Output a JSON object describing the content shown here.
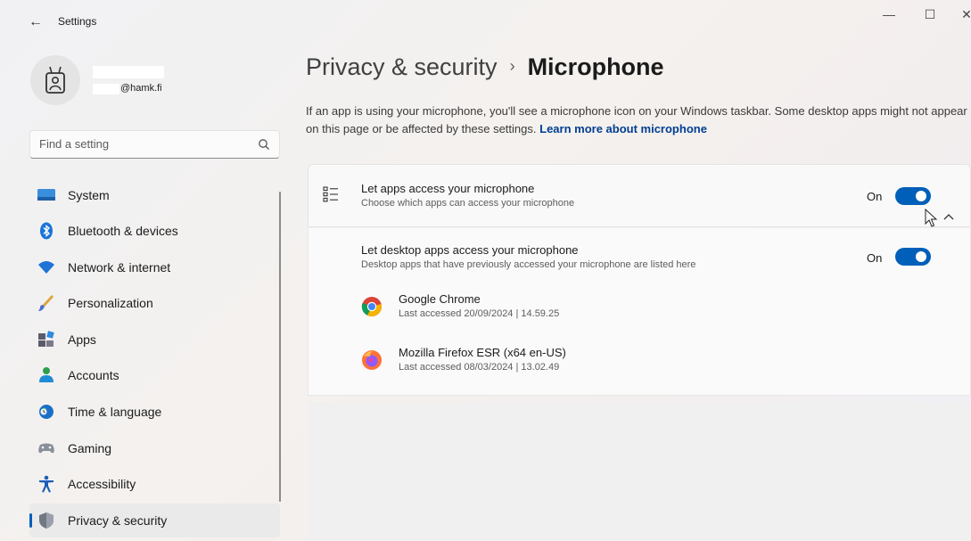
{
  "titlebar": {
    "title": "Settings",
    "back_icon": "←",
    "minimize_icon": "—",
    "maximize_icon": "☐",
    "close_icon": "✕"
  },
  "profile": {
    "email": "@hamk.fi"
  },
  "search": {
    "placeholder": "Find a setting"
  },
  "sidebar": {
    "items": [
      {
        "label": "System",
        "icon": "monitor-icon"
      },
      {
        "label": "Bluetooth & devices",
        "icon": "bluetooth-icon"
      },
      {
        "label": "Network & internet",
        "icon": "wifi-icon"
      },
      {
        "label": "Personalization",
        "icon": "brush-icon"
      },
      {
        "label": "Apps",
        "icon": "apps-icon"
      },
      {
        "label": "Accounts",
        "icon": "person-icon"
      },
      {
        "label": "Time & language",
        "icon": "globe-clock-icon"
      },
      {
        "label": "Gaming",
        "icon": "gamepad-icon"
      },
      {
        "label": "Accessibility",
        "icon": "accessibility-icon"
      },
      {
        "label": "Privacy & security",
        "icon": "shield-icon",
        "active": true
      }
    ]
  },
  "main": {
    "breadcrumb": {
      "parent": "Privacy & security",
      "separator": "›",
      "current": "Microphone"
    },
    "description": "If an app is using your microphone, you'll see a microphone icon on your Windows taskbar. Some desktop apps might not appear on this page or be affected by these settings.",
    "learn_more": "Learn more about microphone",
    "apps_access": {
      "title": "Let apps access your microphone",
      "subtitle": "Choose which apps can access your microphone",
      "state_label": "On"
    },
    "desktop_access": {
      "title": "Let desktop apps access your microphone",
      "subtitle": "Desktop apps that have previously accessed your microphone are listed here",
      "state_label": "On"
    },
    "desktop_apps": [
      {
        "name": "Google Chrome",
        "last_accessed": "Last accessed 20/09/2024  |  14.59.25"
      },
      {
        "name": "Mozilla Firefox ESR (x64 en-US)",
        "last_accessed": "Last accessed 08/03/2024  |  13.02.49"
      }
    ]
  },
  "colors": {
    "accent": "#005fb8",
    "link": "#003e92"
  }
}
